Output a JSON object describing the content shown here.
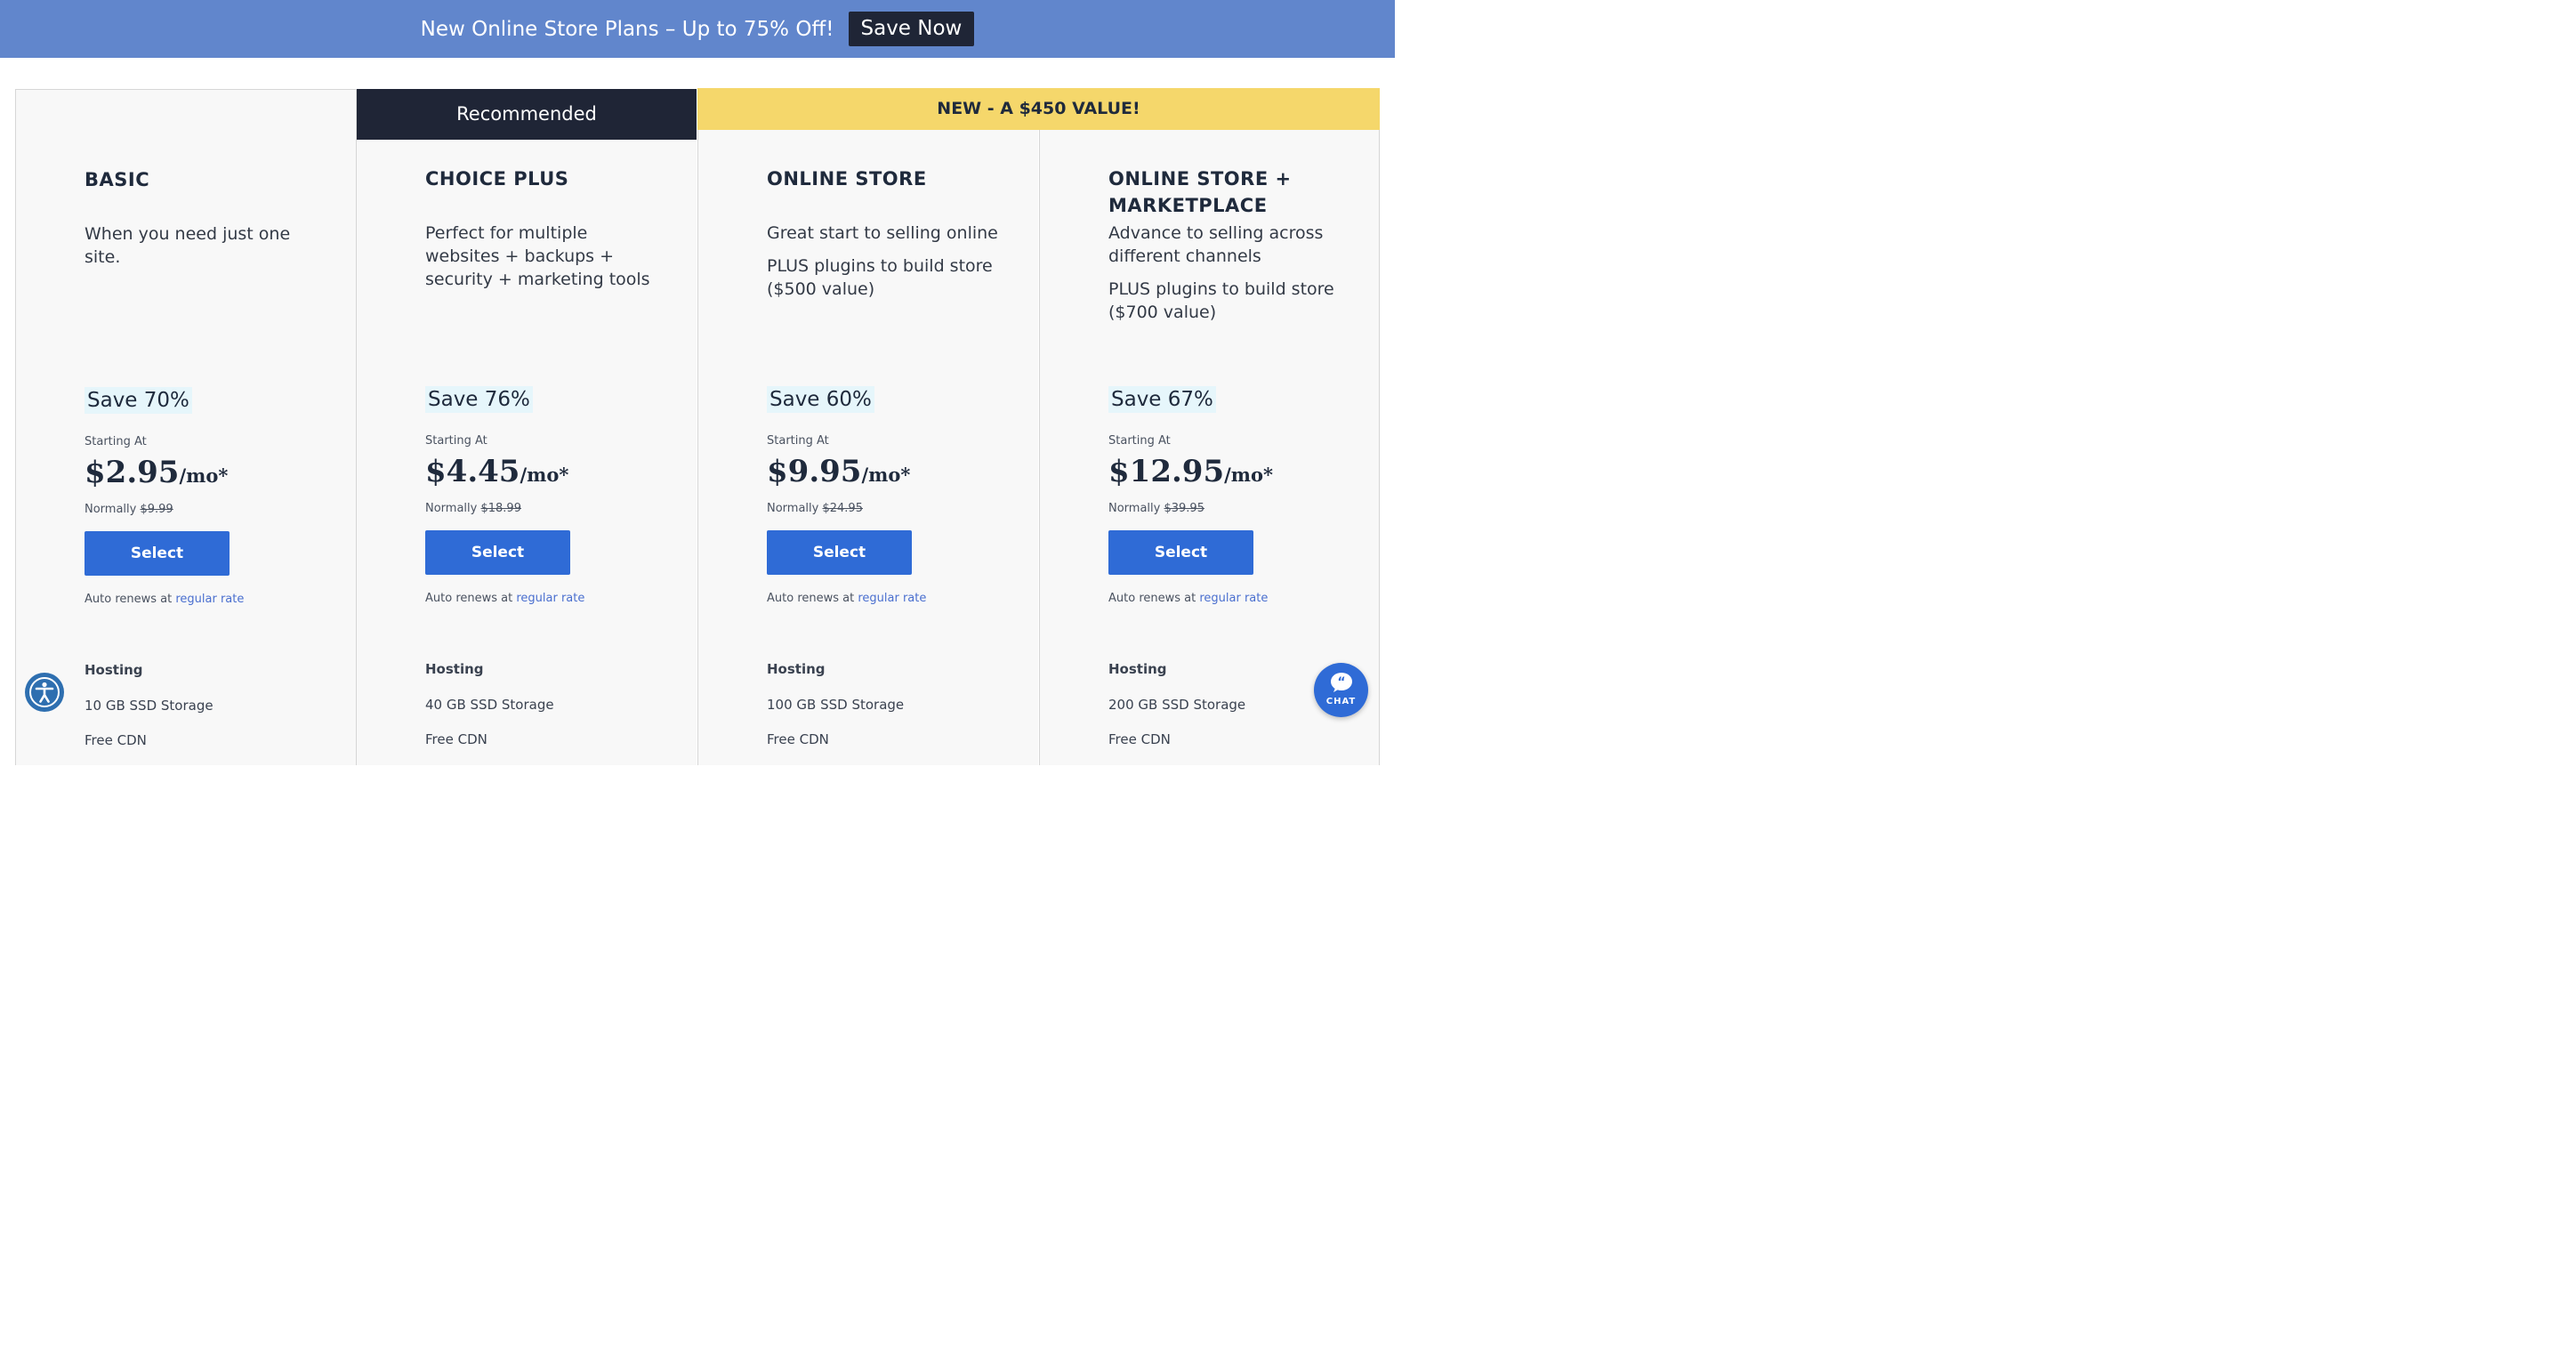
{
  "banner": {
    "text": "New Online Store Plans – Up to 75% Off!",
    "button": "Save Now"
  },
  "headers": {
    "recommended": "Recommended",
    "new_value": "NEW - A $450 VALUE!"
  },
  "plans": [
    {
      "name": "BASIC",
      "desc": [
        "When you need just one site."
      ],
      "save": "Save 70%",
      "starting": "Starting At",
      "price": "$2.95",
      "unit": "/mo*",
      "normally_label": "Normally",
      "normally_price": "$9.99",
      "select": "Select",
      "renews_text": "Auto renews at",
      "renews_link": "regular rate",
      "feature_heading": "Hosting",
      "feature_1": "10 GB SSD Storage",
      "feature_2": "Free CDN"
    },
    {
      "name": "CHOICE PLUS",
      "desc": [
        "Perfect for multiple websites + backups + security + marketing tools"
      ],
      "save": "Save 76%",
      "starting": "Starting At",
      "price": "$4.45",
      "unit": "/mo*",
      "normally_label": "Normally",
      "normally_price": "$18.99",
      "select": "Select",
      "renews_text": "Auto renews at",
      "renews_link": "regular rate",
      "feature_heading": "Hosting",
      "feature_1": "40 GB SSD Storage",
      "feature_2": "Free CDN"
    },
    {
      "name": "ONLINE STORE",
      "desc": [
        "Great start to selling online",
        "PLUS plugins to build store ($500 value)"
      ],
      "save": "Save 60%",
      "starting": "Starting At",
      "price": "$9.95",
      "unit": "/mo*",
      "normally_label": "Normally",
      "normally_price": "$24.95",
      "select": "Select",
      "renews_text": "Auto renews at",
      "renews_link": "regular rate",
      "feature_heading": "Hosting",
      "feature_1": "100 GB SSD Storage",
      "feature_2": "Free CDN"
    },
    {
      "name": "ONLINE STORE + MARKETPLACE",
      "desc": [
        "Advance to selling across different channels",
        "PLUS plugins to build store ($700 value)"
      ],
      "save": "Save 67%",
      "starting": "Starting At",
      "price": "$12.95",
      "unit": "/mo*",
      "normally_label": "Normally",
      "normally_price": "$39.95",
      "select": "Select",
      "renews_text": "Auto renews at",
      "renews_link": "regular rate",
      "feature_heading": "Hosting",
      "feature_1": "200 GB SSD Storage",
      "feature_2": "Free CDN"
    }
  ],
  "chat": {
    "label": "CHAT",
    "icon": "chat-bubble-icon"
  },
  "accessibility": {
    "icon": "accessibility-icon"
  },
  "colors": {
    "banner_bg": "#6186cc",
    "dark": "#1f2536",
    "yellow": "#f5d76b",
    "button_blue": "#2f6bd6",
    "save_bg": "#e6f6fb"
  }
}
